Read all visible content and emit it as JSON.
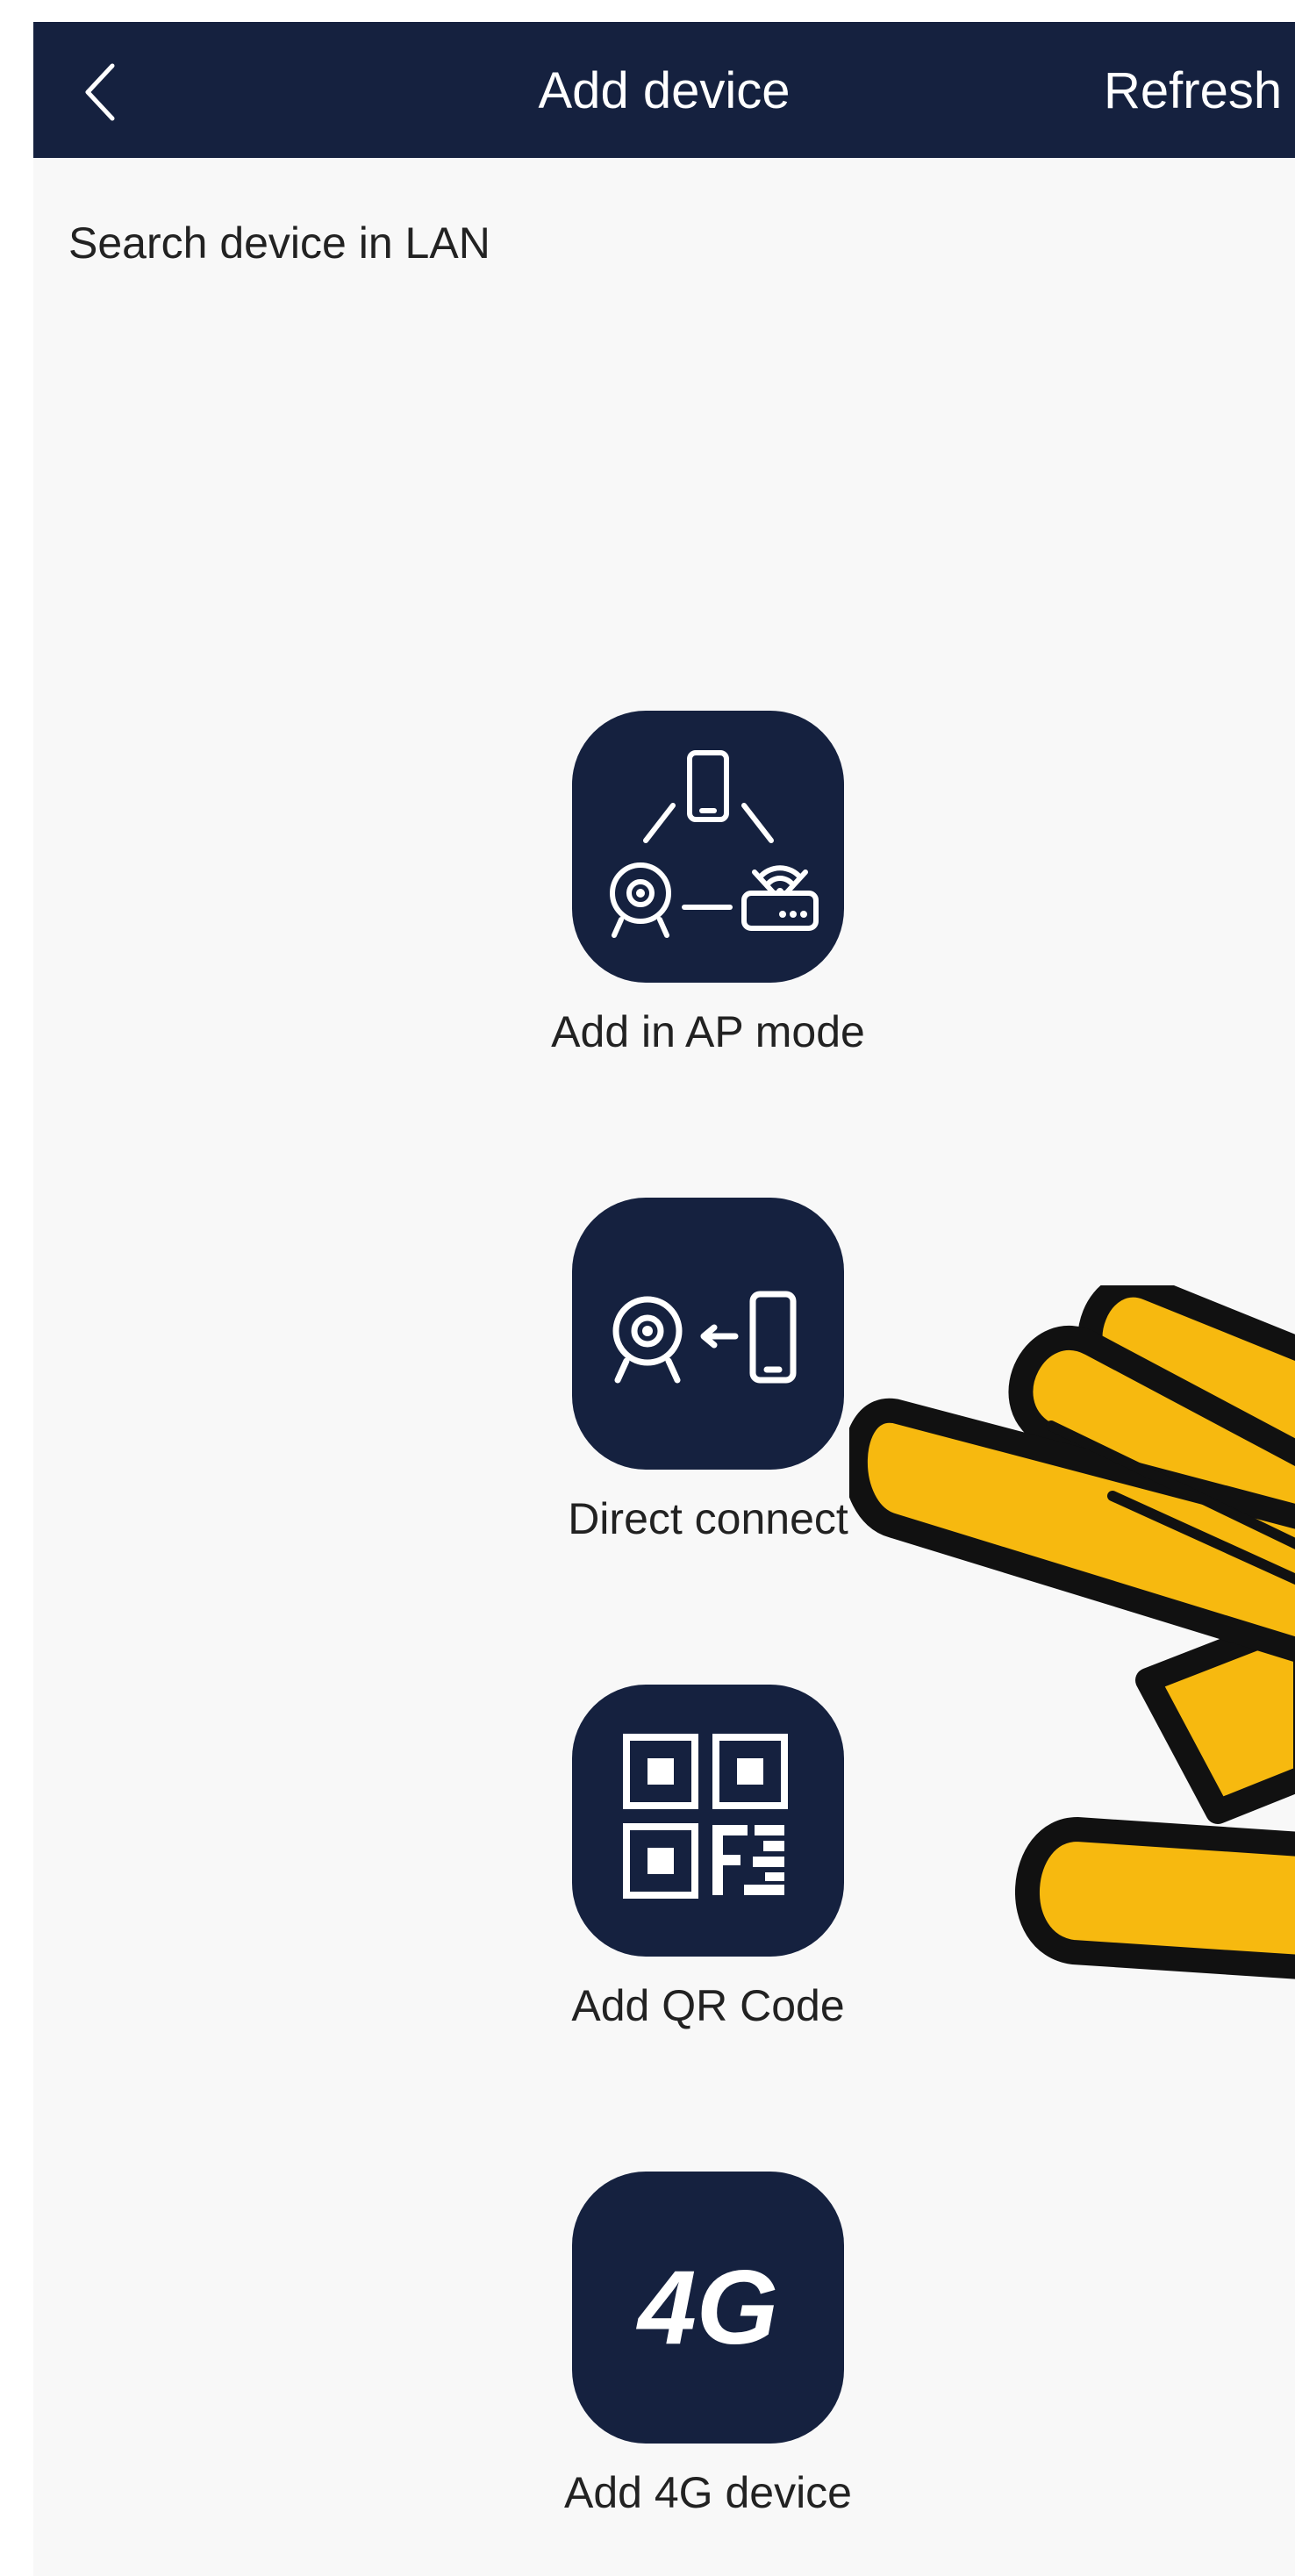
{
  "header": {
    "back_icon": "chevron-left-icon",
    "title": "Add device",
    "refresh_label": "Refresh"
  },
  "section": {
    "label": "Search device in LAN"
  },
  "options": [
    {
      "id": "ap-mode",
      "icon": "phone-camera-router-icon",
      "label": "Add in AP mode"
    },
    {
      "id": "direct-connect",
      "icon": "camera-phone-connect-icon",
      "label": "Direct connect"
    },
    {
      "id": "qr-code",
      "icon": "qr-code-icon",
      "label": "Add QR Code",
      "highlighted_by_hand": true
    },
    {
      "id": "4g-device",
      "icon": "4g-icon",
      "icon_text": "4G",
      "label": "Add 4G device"
    }
  ],
  "overlay": {
    "icon": "pointing-hand-icon"
  },
  "colors": {
    "header_bg": "#15213f",
    "tile_bg": "#15213f",
    "page_bg": "#f8f8f8",
    "hand_fill": "#f7b90f",
    "hand_outline": "#111111"
  }
}
